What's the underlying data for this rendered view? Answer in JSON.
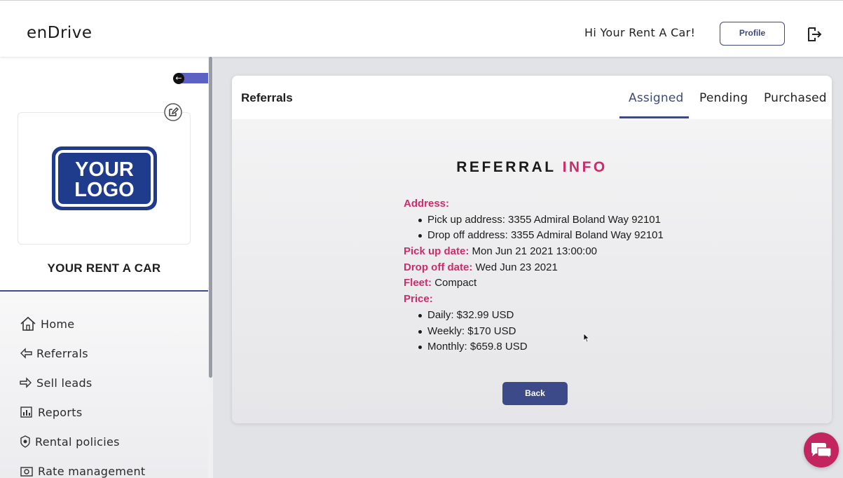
{
  "header": {
    "brand": "enDrive",
    "greeting": "Hi Your Rent A Car!",
    "profile_label": "Profile",
    "logout_icon": "logout-icon"
  },
  "sidebar": {
    "company_logo_text": "YOUR LOGO",
    "company_name": "YOUR RENT A CAR",
    "items": [
      {
        "label": "Home",
        "icon": "home-icon"
      },
      {
        "label": "Referrals",
        "icon": "arrow-left-icon"
      },
      {
        "label": "Sell leads",
        "icon": "arrow-right-icon"
      },
      {
        "label": "Reports",
        "icon": "bar-chart-icon"
      },
      {
        "label": "Rental policies",
        "icon": "shield-icon"
      },
      {
        "label": "Rate management",
        "icon": "cash-icon"
      }
    ]
  },
  "main": {
    "title": "Referrals",
    "tabs": [
      {
        "label": "Assigned",
        "active": true
      },
      {
        "label": "Pending",
        "active": false
      },
      {
        "label": "Purchased",
        "active": false
      }
    ],
    "heading_main": "REFERRAL",
    "heading_accent": "INFO",
    "info": {
      "address_label": "Address:",
      "pickup_address": "Pick up address: 3355 Admiral Boland Way 92101",
      "dropoff_address": "Drop off address: 3355 Admiral Boland Way 92101",
      "pickup_date_label": "Pick up date:",
      "pickup_date": "Mon Jun 21 2021 13:00:00",
      "dropoff_date_label": "Drop off date:",
      "dropoff_date": "Wed Jun 23 2021",
      "fleet_label": "Fleet:",
      "fleet": "Compact",
      "price_label": "Price:",
      "daily": "Daily: $32.99 USD",
      "weekly": "Weekly: $170 USD",
      "monthly": "Monthly: $659.8 USD"
    },
    "back_label": "Back"
  },
  "colors": {
    "accent_pink": "#cc2d6a",
    "brand_navy": "#3d4a7a",
    "chat_bubble": "#c2255f"
  }
}
